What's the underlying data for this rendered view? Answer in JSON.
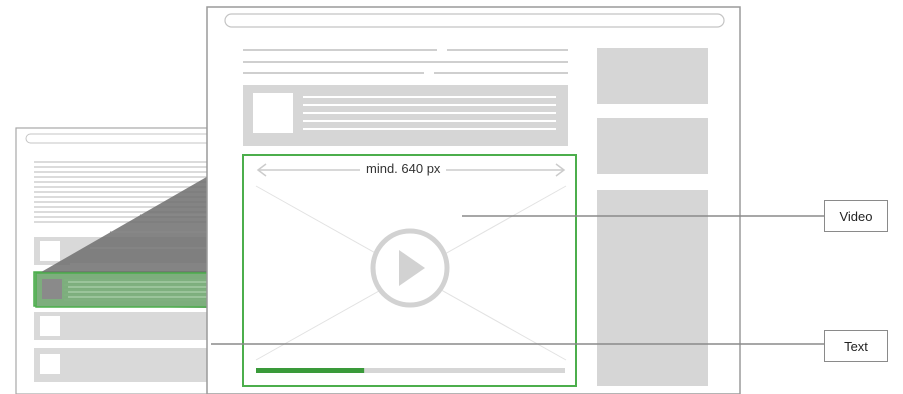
{
  "video_frame": {
    "width_label": "mind. 640 px",
    "progress": 0.35
  },
  "callouts": {
    "video": "Video",
    "text": "Text"
  },
  "colors": {
    "accent_green": "#4cae4c",
    "progress_green": "#3a9a3a",
    "placeholder_gray": "#d6d6d6",
    "line_gray": "#cfcfcf",
    "frame_border": "#9a9a9a"
  }
}
